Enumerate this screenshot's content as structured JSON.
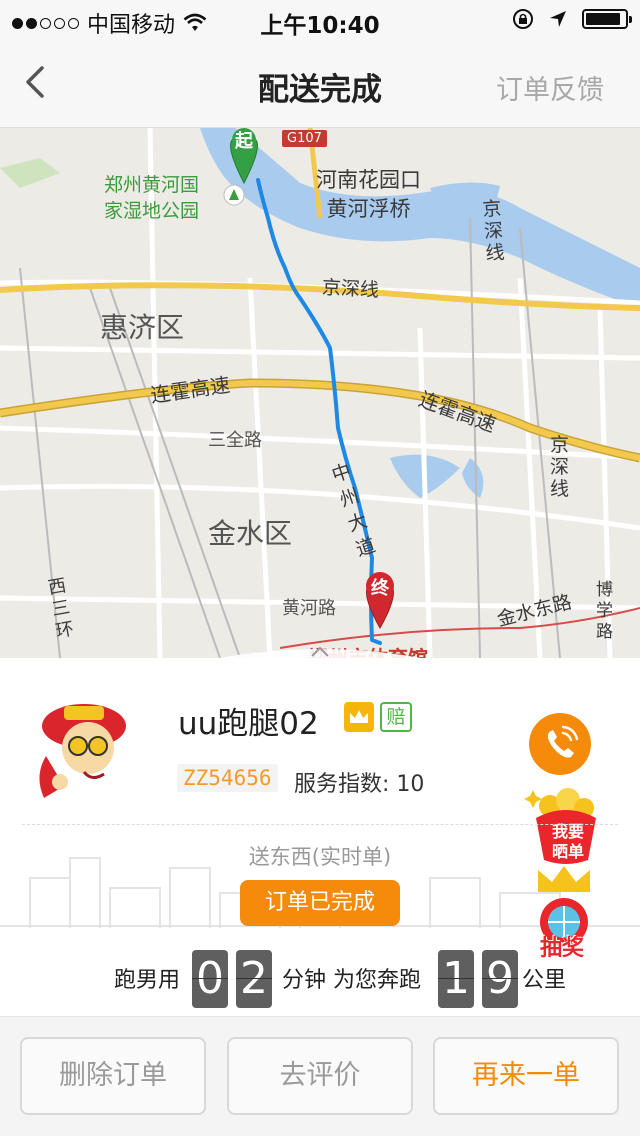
{
  "status_bar": {
    "carrier": "中国移动",
    "time": "上午10:40",
    "battery_level": 0.9
  },
  "nav": {
    "title": "配送完成",
    "feedback": "订单反馈"
  },
  "map": {
    "labels": {
      "park": "郑州黄河国家湿地公园",
      "park_line1": "郑州黄河国",
      "park_line2": "家湿地公园",
      "g107": "G107",
      "bridge_line1": "河南花园口",
      "bridge_line2": "黄河浮桥",
      "jingshen_vertical": "京深线",
      "jingshen": "京深线",
      "huiji": "惠济区",
      "lianhuo_left": "连霍高速",
      "lianhuo_right": "连霍高速",
      "sanquan": "三全路",
      "jinshui": "金水区",
      "zhongzhou": "中州大道",
      "huanghe": "黄河路",
      "jinshuidong": "金水东路",
      "boxue": "博学路",
      "xisanhuan": "西三环",
      "stadium": "郑州市体育馆",
      "jingshen_right": "京深线"
    },
    "start_marker": "起",
    "end_marker": "终",
    "colors": {
      "route": "#1e88e5",
      "water": "#a9cbee",
      "highway": "#f2c94c",
      "start": "#35a043",
      "end": "#d0282f"
    }
  },
  "rider": {
    "name": "uu跑腿02",
    "badge_insured": "赔",
    "id": "ZZ54656",
    "rating_label": "服务指数:",
    "rating_value": "10"
  },
  "order": {
    "type": "送东西(实时单)",
    "status": "订单已完成",
    "stat_prefix": "跑男用",
    "minutes_digits": [
      "0",
      "2"
    ],
    "stat_middle": "分钟 为您奔跑",
    "km_digits": [
      "1",
      "9"
    ],
    "stat_suffix": "公里"
  },
  "side_icons": {
    "share_line1": "我要",
    "share_line2": "晒单",
    "lottery": "抽奖"
  },
  "buttons": {
    "delete": "删除订单",
    "review": "去评价",
    "reorder": "再来一单"
  },
  "brand_colors": {
    "accent": "#f58a0b",
    "green": "#53b548"
  }
}
